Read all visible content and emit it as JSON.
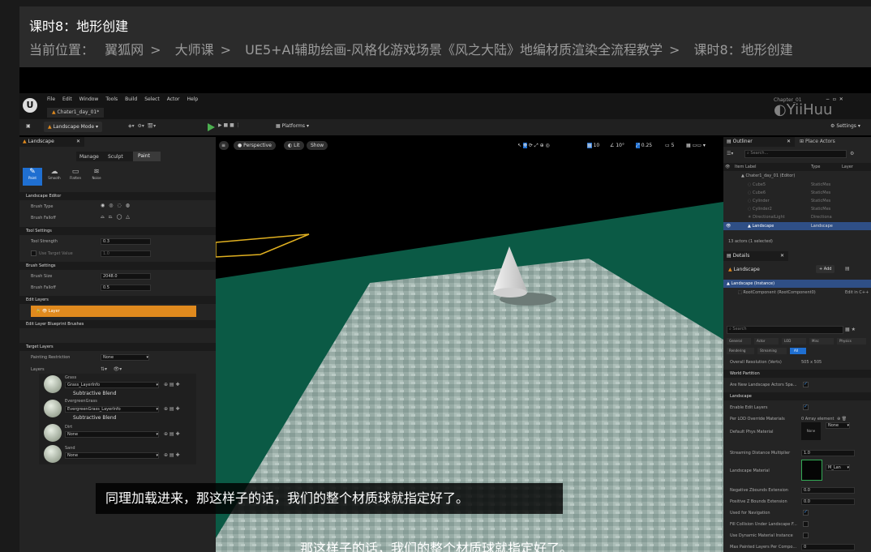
{
  "lesson_title": "课时8：地形创建",
  "breadcrumb": {
    "prefix": "当前位置：",
    "items": [
      "翼狐网",
      "大师课",
      "UE5+AI辅助绘画-风格化游戏场景《风之大陆》地编材质渲染全流程教学",
      "课时8：地形创建"
    ],
    "sep": ">"
  },
  "watermark": "YiiHuu",
  "ue": {
    "menu": [
      "File",
      "Edit",
      "Window",
      "Tools",
      "Build",
      "Select",
      "Actor",
      "Help"
    ],
    "tab": "Chater1_day_01*",
    "title_tab": "Chapter_01",
    "mode": "Landscape Mode",
    "platforms": "Platforms",
    "settings": "Settings",
    "landscape_tab": "Landscape",
    "subtabs": [
      "Manage",
      "Sculpt",
      "Paint"
    ],
    "tools": [
      "Paint",
      "Smooth",
      "Flatten",
      "Noise"
    ],
    "sections": {
      "editor": "Landscape Editor",
      "tool": "Tool Settings",
      "brush": "Brush Settings",
      "edit_layers": "Edit Layers",
      "elbp": "Edit Layer Blueprint Brushes",
      "target": "Target Layers"
    },
    "rows": {
      "brush_type": "Brush Type",
      "brush_falloff": "Brush Falloff",
      "tool_strength": "Tool Strength",
      "tool_strength_val": "0.3",
      "use_target": "Use Target Value",
      "use_target_val": "1.0",
      "brush_size": "Brush Size",
      "brush_size_val": "2048.0",
      "falloff": "Brush Falloff",
      "falloff_val": "0.5",
      "painting_restriction": "Painting Restriction",
      "painting_restriction_val": "None",
      "layers": "Layers"
    },
    "layer_item": "Layer",
    "target_layers": [
      {
        "name": "Grass",
        "info": "Grass_LayerInfo",
        "blend": "Subtractive Blend"
      },
      {
        "name": "EvergreenGrass",
        "info": "EvergreenGrass_LayerInfo",
        "blend": "Subtractive Blend"
      },
      {
        "name": "Dirt",
        "info": "None",
        "blend": ""
      },
      {
        "name": "Sand",
        "info": "None",
        "blend": ""
      }
    ],
    "viewport": {
      "persp": "Perspective",
      "lit": "Lit",
      "show": "Show",
      "grid": "10",
      "angle": "10°",
      "scale": "0.25",
      "cam": "5"
    },
    "outliner": {
      "tab": "Outliner",
      "tab2": "Place Actors",
      "search": "Search...",
      "col_label": "Item Label",
      "col_type": "Type",
      "col_layer": "Layer",
      "rows": [
        {
          "label": "Chater1_day_01 (Editor)",
          "type": ""
        },
        {
          "label": "Cube5",
          "type": "StaticMes"
        },
        {
          "label": "Cube6",
          "type": "StaticMes"
        },
        {
          "label": "Cylinder",
          "type": "StaticMes"
        },
        {
          "label": "Cylinder2",
          "type": "StaticMes"
        },
        {
          "label": "DirectionalLight",
          "type": "Directiona"
        },
        {
          "label": "Landscape",
          "type": "Landscape"
        }
      ],
      "count": "13 actors (1 selected)"
    },
    "details": {
      "tab": "Details",
      "name": "Landscape",
      "add": "+ Add",
      "instance": "Landscape (Instance)",
      "root": "RootComponent (RootComponent0)",
      "edit": "Edit in C++",
      "search": "Search",
      "filters": [
        "General",
        "Actor",
        "LOD",
        "Misc",
        "Physics",
        "Rendering",
        "Streaming",
        "All"
      ],
      "overall_label": "Overall Resolution (Verts)",
      "overall_val": "505 x 505",
      "sec_wp": "World Partition",
      "wp_row": "Are New Landscape Actors Spa...",
      "sec_land": "Landscape",
      "rows": [
        "Enable Edit Layers",
        "Per LOD Override Materials",
        "Default Phys Material",
        "Streaming Distance Multiplier",
        "Landscape Material",
        "Negative Zbounds Extension",
        "Positive Z Bounds Extension",
        "Used for Navigation",
        "Fill Collision Under Landscape F...",
        "Use Dynamic Material Instance",
        "Max Painted Layers Per Compo..."
      ],
      "lod_val": "0 Array element",
      "phys_val": "None",
      "phys_thumb": "None",
      "stream_val": "1.0",
      "mat_val": "M_Lan",
      "neg_val": "0.0",
      "pos_val": "0.0",
      "max_val": "0"
    }
  },
  "subtitle": "同理加载进来，那这样子的话，我们的整个材质球就指定好了。",
  "subtitle_burned": "那这样子的话，我们的整个材质球就指定好了。",
  "colors": {
    "accent": "#3a8ee6",
    "layer_orange": "#e08a1e",
    "sea": "#0b5a45"
  }
}
